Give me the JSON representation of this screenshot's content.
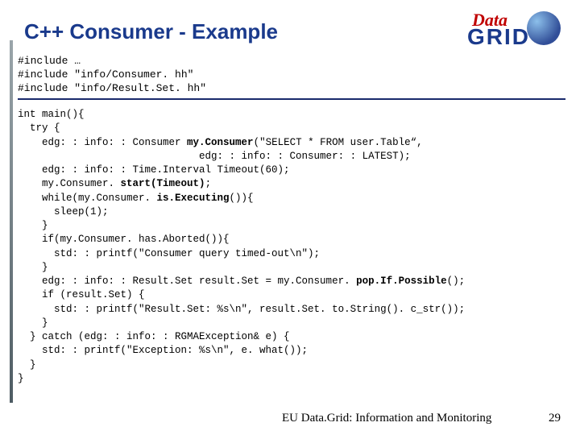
{
  "title": "C++ Consumer - Example",
  "logo": {
    "top": "Data",
    "bottom": "GRID"
  },
  "includes": "#include …\n#include \"info/Consumer. hh\"\n#include \"info/Result.Set. hh\"",
  "code_lines": [
    {
      "indent": 0,
      "segs": [
        {
          "t": "int main(){"
        }
      ]
    },
    {
      "indent": 1,
      "segs": [
        {
          "t": "try {"
        }
      ]
    },
    {
      "indent": 2,
      "segs": [
        {
          "t": "edg: : info: : Consumer "
        },
        {
          "t": "my.Consumer",
          "b": true
        },
        {
          "t": "(\"SELECT * FROM user.Table“,"
        }
      ]
    },
    {
      "indent": 15,
      "segs": [
        {
          "t": "edg: : info: : Consumer: : LATEST);"
        }
      ]
    },
    {
      "indent": 2,
      "segs": [
        {
          "t": "edg: : info: : Time.Interval Timeout(60);"
        }
      ]
    },
    {
      "indent": 2,
      "segs": [
        {
          "t": "my.Consumer. "
        },
        {
          "t": "start(Timeout)",
          "b": true
        },
        {
          "t": ";"
        }
      ]
    },
    {
      "indent": 2,
      "segs": [
        {
          "t": "while(my.Consumer. "
        },
        {
          "t": "is.Executing",
          "b": true
        },
        {
          "t": "()){"
        }
      ]
    },
    {
      "indent": 3,
      "segs": [
        {
          "t": "sleep(1);"
        }
      ]
    },
    {
      "indent": 2,
      "segs": [
        {
          "t": "}"
        }
      ]
    },
    {
      "indent": 2,
      "segs": [
        {
          "t": "if(my.Consumer. has.Aborted()){"
        }
      ]
    },
    {
      "indent": 3,
      "segs": [
        {
          "t": "std: : printf(\"Consumer query timed-out\\n\");"
        }
      ]
    },
    {
      "indent": 2,
      "segs": [
        {
          "t": "}"
        }
      ]
    },
    {
      "indent": 2,
      "segs": [
        {
          "t": "edg: : info: : Result.Set result.Set = my.Consumer. "
        },
        {
          "t": "pop.If.Possible",
          "b": true
        },
        {
          "t": "();"
        }
      ]
    },
    {
      "indent": 2,
      "segs": [
        {
          "t": "if (result.Set) {"
        }
      ]
    },
    {
      "indent": 3,
      "segs": [
        {
          "t": "std: : printf(\"Result.Set: %s\\n\", result.Set. to.String(). c_str());"
        }
      ]
    },
    {
      "indent": 2,
      "segs": [
        {
          "t": "}"
        }
      ]
    },
    {
      "indent": 1,
      "segs": [
        {
          "t": "} catch (edg: : info: : RGMAException& e) {"
        }
      ]
    },
    {
      "indent": 2,
      "segs": [
        {
          "t": "std: : printf(\"Exception: %s\\n\", e. what());"
        }
      ]
    },
    {
      "indent": 1,
      "segs": [
        {
          "t": "}"
        }
      ]
    },
    {
      "indent": 0,
      "segs": [
        {
          "t": "}"
        }
      ]
    }
  ],
  "footer": "EU Data.Grid: Information and Monitoring",
  "page": "29"
}
